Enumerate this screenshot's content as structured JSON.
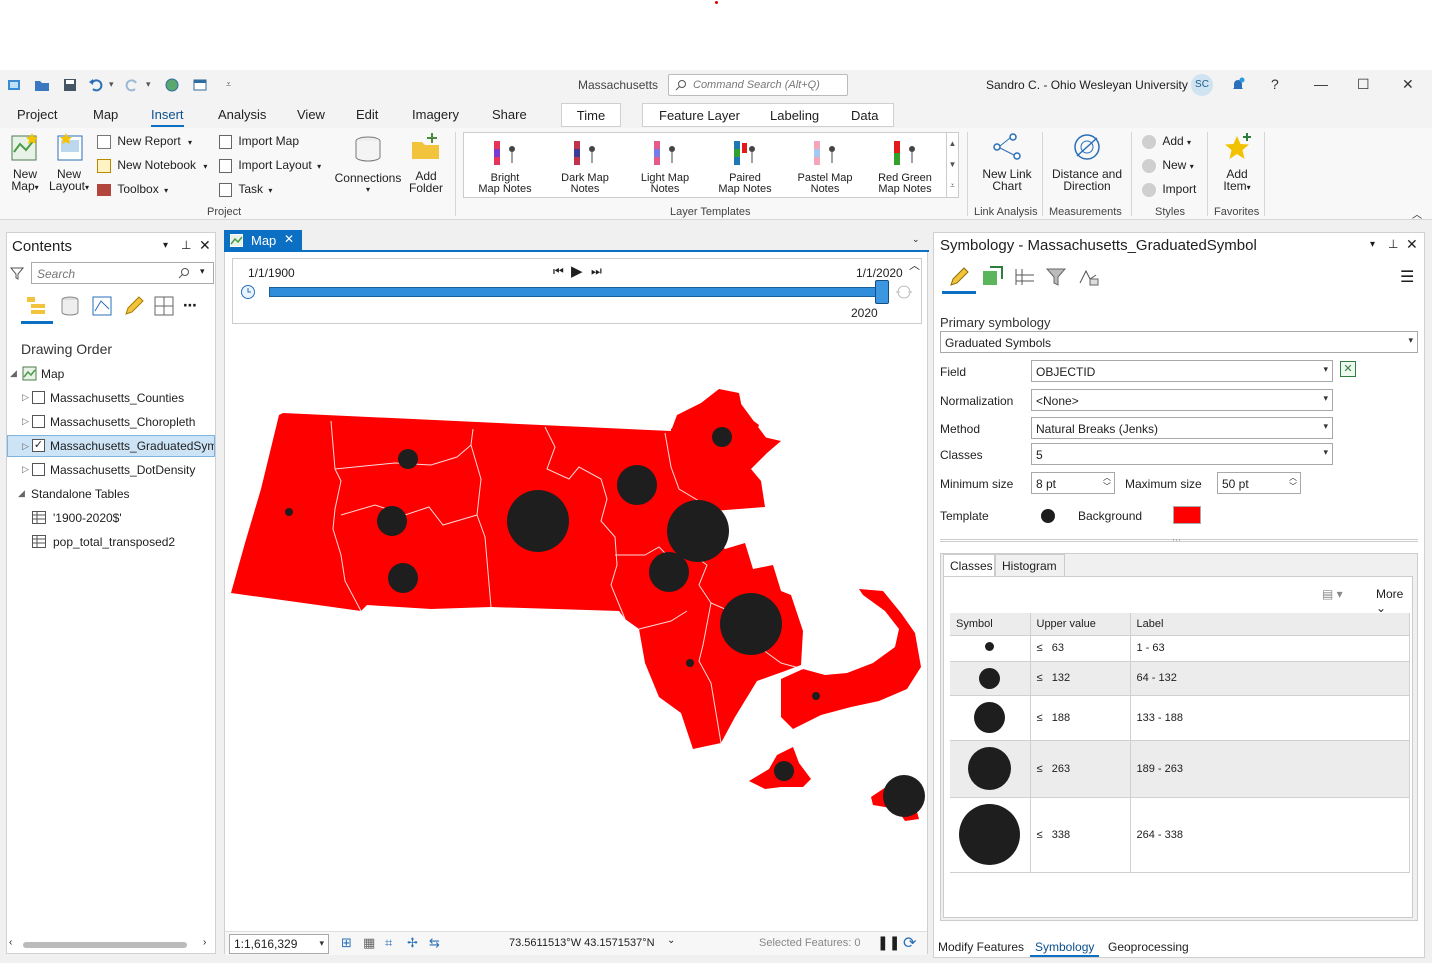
{
  "app": {
    "project_name": "Massachusetts",
    "command_search_placeholder": "Command Search (Alt+Q)",
    "user": "Sandro C. - Ohio Wesleyan University",
    "avatar_initials": "SC"
  },
  "tabs": [
    "Project",
    "Map",
    "Insert",
    "Analysis",
    "View",
    "Edit",
    "Imagery",
    "Share"
  ],
  "active_tab": "Insert",
  "context_tabs": {
    "time": "Time",
    "feature_layer": "Feature Layer",
    "labeling": "Labeling",
    "data": "Data"
  },
  "ribbon": {
    "project": {
      "new_map_1": "New",
      "new_map_2": "Map",
      "new_layout_1": "New",
      "new_layout_2": "Layout",
      "new_report": "New Report",
      "new_notebook": "New Notebook",
      "toolbox": "Toolbox",
      "import_map": "Import Map",
      "import_layout": "Import Layout",
      "task": "Task",
      "connections": "Connections",
      "add_folder_1": "Add",
      "add_folder_2": "Folder",
      "label": "Project"
    },
    "layer_templates": {
      "items": [
        {
          "l1": "Bright",
          "l2": "Map Notes"
        },
        {
          "l1": "Dark Map",
          "l2": "Notes"
        },
        {
          "l1": "Light Map",
          "l2": "Notes"
        },
        {
          "l1": "Paired",
          "l2": "Map Notes"
        },
        {
          "l1": "Pastel Map",
          "l2": "Notes"
        },
        {
          "l1": "Red Green",
          "l2": "Map Notes"
        }
      ],
      "label": "Layer Templates"
    },
    "link_analysis": {
      "new_link_chart_1": "New Link",
      "new_link_chart_2": "Chart",
      "label": "Link Analysis"
    },
    "measurements": {
      "distance_1": "Distance and",
      "distance_2": "Direction",
      "label": "Measurements"
    },
    "styles": {
      "add": "Add",
      "new": "New",
      "import": "Import",
      "label": "Styles"
    },
    "favorites": {
      "add_item_1": "Add",
      "add_item_2": "Item",
      "label": "Favorites"
    }
  },
  "contents": {
    "title": "Contents",
    "search_placeholder": "Search",
    "drawing_order": "Drawing Order",
    "map": "Map",
    "layers": [
      {
        "name": "Massachusetts_Counties",
        "checked": false
      },
      {
        "name": "Massachusetts_Choropleth",
        "checked": false
      },
      {
        "name": "Massachusetts_GraduatedSymb",
        "checked": true
      },
      {
        "name": "Massachusetts_DotDensity",
        "checked": false
      }
    ],
    "standalone_tables": "Standalone Tables",
    "tables": [
      "'1900-2020$'",
      "pop_total_transposed2"
    ]
  },
  "map_view": {
    "tab": "Map",
    "time_start": "1/1/1900",
    "time_end": "1/1/2020",
    "time_current": "2020",
    "scale": "1:1,616,329",
    "coords": "73.5611513°W 43.1571537°N",
    "selected_features": "Selected Features: 0",
    "fill_color": "#ff0000",
    "symbol_color": "#1e1e1e"
  },
  "symbology": {
    "title": "Symbology - Massachusetts_GraduatedSymbol",
    "primary": "Primary symbology",
    "renderer": "Graduated Symbols",
    "field_label": "Field",
    "field": "OBJECTID",
    "normalization_label": "Normalization",
    "normalization": "<None>",
    "method_label": "Method",
    "method": "Natural Breaks (Jenks)",
    "classes_label": "Classes",
    "classes": "5",
    "min_label": "Minimum size",
    "min": "8 pt",
    "max_label": "Maximum size",
    "max": "50 pt",
    "template_label": "Template",
    "background_label": "Background",
    "background_color": "#ff0000",
    "tab_classes": "Classes",
    "tab_histogram": "Histogram",
    "more": "More",
    "col_symbol": "Symbol",
    "col_upper": "Upper value",
    "col_label": "Label",
    "rows": [
      {
        "le": "≤",
        "upper": "63",
        "label": "1 - 63"
      },
      {
        "le": "≤",
        "upper": "132",
        "label": "64 - 132"
      },
      {
        "le": "≤",
        "upper": "188",
        "label": "133 - 188"
      },
      {
        "le": "≤",
        "upper": "263",
        "label": "189 - 263"
      },
      {
        "le": "≤",
        "upper": "338",
        "label": "264 - 338"
      }
    ]
  },
  "bottom_tabs": [
    "Modify Features",
    "Symbology",
    "Geoprocessing"
  ]
}
